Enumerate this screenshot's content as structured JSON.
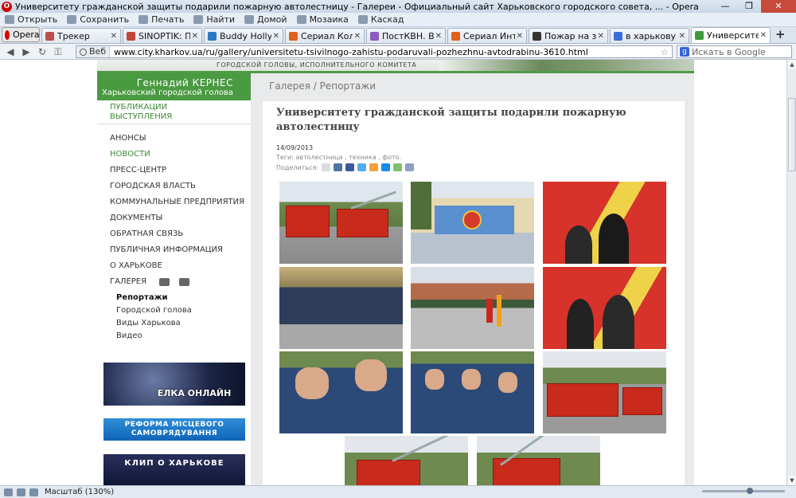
{
  "window": {
    "title": "Университету гражданской защиты подарили пожарную автолестницу - Галереи - Официальный сайт Харьковского городского совета, ... - Opera",
    "minimize": "—",
    "maximize": "❐",
    "close": "✕"
  },
  "menubar": {
    "items": [
      "Открыть",
      "Сохранить",
      "Печать",
      "Найти",
      "Домой",
      "Мозаика",
      "Каскад"
    ]
  },
  "tabs": {
    "opera_label": "Opera",
    "items": [
      {
        "label": "Трекер",
        "color": "#b8504a"
      },
      {
        "label": "SINOPTIK: Погод...",
        "color": "#c0453a"
      },
      {
        "label": "Buddy Holly скач...",
        "color": "#2b78c2"
      },
      {
        "label": "Сериал Коломб...",
        "color": "#e0601e"
      },
      {
        "label": "ПостКВН. Вечер...",
        "color": "#8a5cbd"
      },
      {
        "label": "Сериал Интерн...",
        "color": "#e0601e"
      },
      {
        "label": "Пожар на завод...",
        "color": "#333333"
      },
      {
        "label": "в харькову пода...",
        "color": "#3a6fd8"
      },
      {
        "label": "Университету гр...",
        "color": "#3e9a3a",
        "active": true
      }
    ],
    "close_glyph": "✕",
    "new_tab": "+"
  },
  "address": {
    "web_label": "Веб",
    "url": "www.city.kharkov.ua/ru/gallery/universitetu-tsivilnogo-zahistu-podaruvali-pozhezhnu-avtodrabinu-3610.html",
    "search_placeholder": "Искать в Google"
  },
  "page": {
    "header_text": "ГОРОДСКОЙ ГОЛОВЫ, ИСПОЛНИТЕЛЬНОГО КОМИТЕТА",
    "mayor_name": "Геннадий КЕРНЕС",
    "mayor_role": "Харьковский городской голова",
    "pubs": [
      "ПУБЛИКАЦИИ",
      "ВЫСТУПЛЕНИЯ"
    ],
    "menu": [
      {
        "label": "АНОНСЫ",
        "active": false
      },
      {
        "label": "НОВОСТИ",
        "active": true
      },
      {
        "label": "ПРЕСС-ЦЕНТР",
        "active": false
      },
      {
        "label": "ГОРОДСКАЯ ВЛАСТЬ",
        "active": false
      },
      {
        "label": "КОММУНАЛЬНЫЕ ПРЕДПРИЯТИЯ",
        "active": false
      },
      {
        "label": "ДОКУМЕНТЫ",
        "active": false
      },
      {
        "label": "ОБРАТНАЯ СВЯЗЬ",
        "active": false
      },
      {
        "label": "ПУБЛИЧНАЯ ИНФОРМАЦИЯ",
        "active": false
      },
      {
        "label": "О ХАРЬКОВЕ",
        "active": false
      }
    ],
    "gallery_label": "ГАЛЕРЕЯ",
    "gallery_sub": [
      "Репортажи",
      "Городской голова",
      "Виды Харькова",
      "Видео"
    ],
    "banners": {
      "b1": "ЕЛКА ОНЛАЙН",
      "b2_line1": "РЕФОРМА МІСЦЕВОГО",
      "b2_line2": "САМОВРЯДУВАННЯ",
      "b3": "КЛИП О ХАРЬКОВЕ"
    },
    "breadcrumb": "Галерея   /  Репортажи",
    "article_title": "Университету гражданской защиты подарили пожарную автолестницу",
    "date": "14/09/2013",
    "tags": "Теги: автолестница ,  техника ,  фото.",
    "share_label": "Поделиться:"
  },
  "status": {
    "zoom": "Масштаб (130%)"
  }
}
